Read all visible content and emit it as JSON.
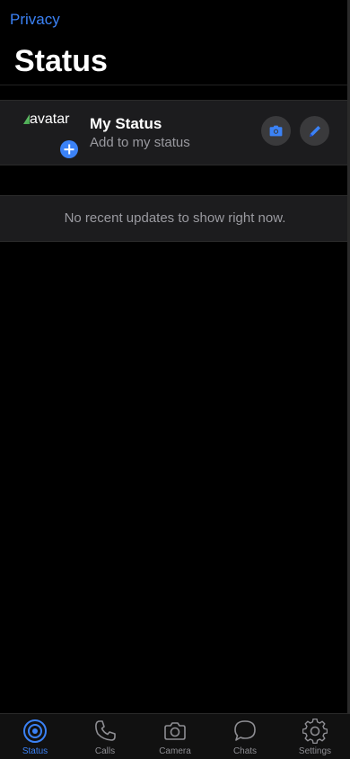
{
  "header": {
    "privacy_label": "Privacy",
    "title": "Status"
  },
  "my_status": {
    "avatar_alt": "avatar",
    "name": "My Status",
    "subtitle": "Add to my status",
    "camera_icon": "camera-icon",
    "pencil_icon": "pencil-icon"
  },
  "updates": {
    "empty_text": "No recent updates to show right now."
  },
  "tabbar": {
    "active": "Status",
    "tabs": [
      {
        "label": "Status",
        "icon": "status-ring-icon"
      },
      {
        "label": "Calls",
        "icon": "phone-icon"
      },
      {
        "label": "Camera",
        "icon": "camera-icon"
      },
      {
        "label": "Chats",
        "icon": "chat-bubble-icon"
      },
      {
        "label": "Settings",
        "icon": "gear-icon"
      }
    ]
  },
  "colors": {
    "accent": "#3b82f6",
    "background": "#000000",
    "surface": "#1c1c1e",
    "muted_text": "#9a9aa0",
    "inactive_tab": "#8e8e93"
  }
}
